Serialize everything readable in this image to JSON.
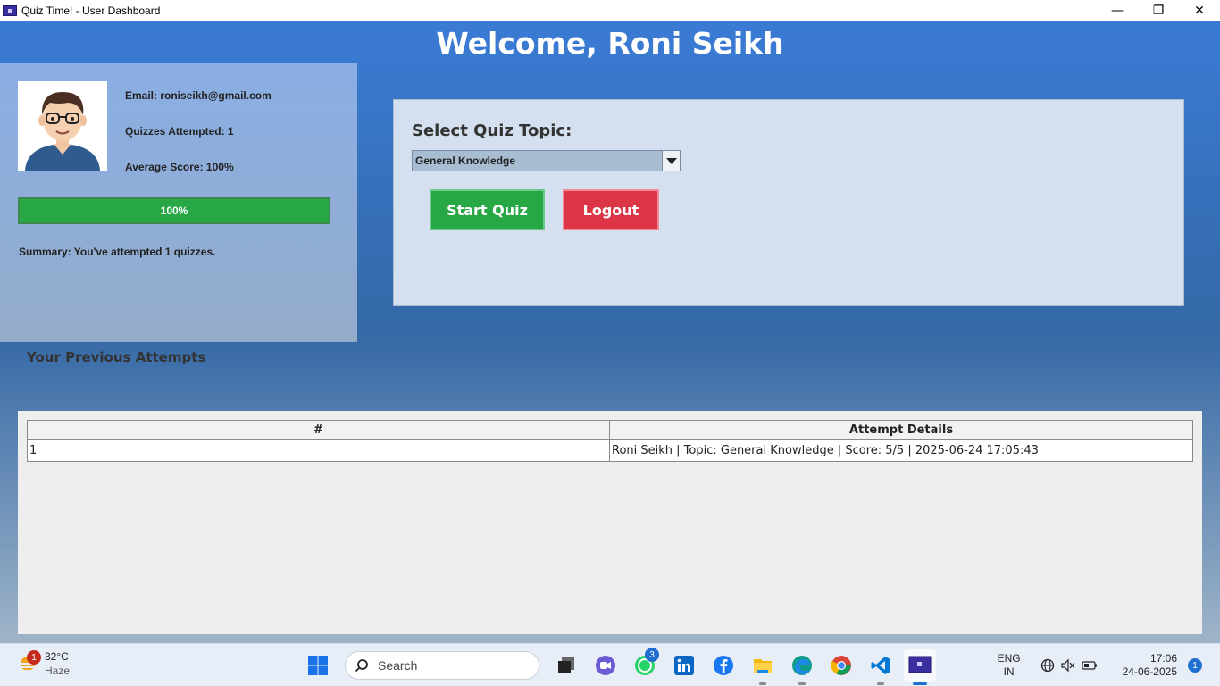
{
  "window": {
    "title": "Quiz Time! - User Dashboard",
    "minimize": "—",
    "maximize": "❐",
    "close": "✕"
  },
  "header": {
    "welcome": "Welcome, Roni Seikh"
  },
  "profile": {
    "email": "Email: roniseikh@gmail.com",
    "quizzes_attempted": "Quizzes Attempted: 1",
    "average_score": "Average Score: 100%",
    "progress_label": "100%",
    "progress_value": 1.0,
    "summary": "Summary: You've attempted 1 quizzes."
  },
  "quiz": {
    "select_label": "Select Quiz Topic:",
    "selected_topic": "General Knowledge",
    "start_button": "Start Quiz",
    "logout_button": "Logout"
  },
  "attempts": {
    "title": "Your Previous Attempts",
    "columns": [
      "#",
      "Attempt Details"
    ],
    "rows": [
      [
        "1",
        "Roni Seikh | Topic: General Knowledge | Score: 5/5 | 2025-06-24 17:05:43"
      ]
    ]
  },
  "taskbar": {
    "weather_temp": "32°C",
    "weather_desc": "Haze",
    "weather_badge": "1",
    "search_placeholder": "Search",
    "whatsapp_badge": "3",
    "lang_top": "ENG",
    "lang_bottom": "IN",
    "time": "17:06",
    "date": "24-06-2025",
    "notification_count": "1"
  },
  "colors": {
    "accent_blue": "#3a7bd5",
    "start_green": "#28a745",
    "logout_red": "#dc3545"
  }
}
